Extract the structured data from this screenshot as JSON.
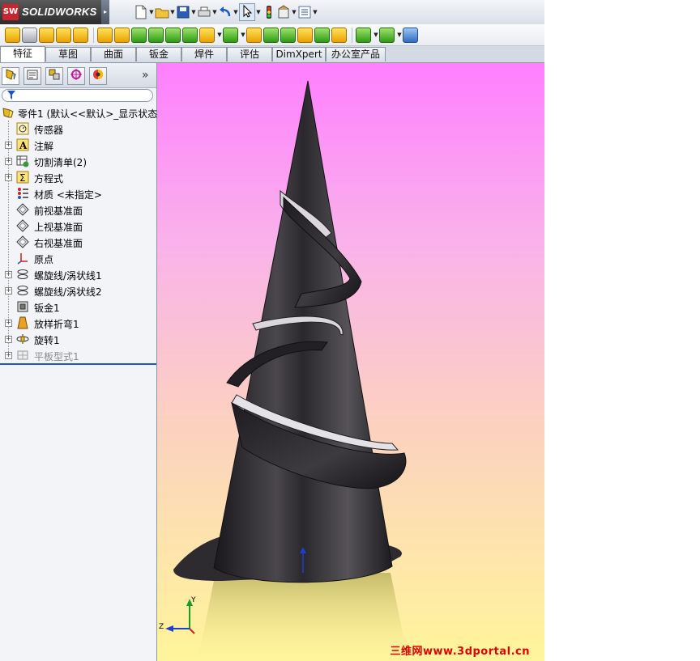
{
  "app": {
    "logo_mark": "SW",
    "logo_text": "SOLIDWORKS",
    "menu_arrow": "▸"
  },
  "toolbar": {
    "icons": [
      "new-icon",
      "open-icon",
      "save-icon",
      "print-icon",
      "undo-icon",
      "select-icon",
      "rebuild-icon",
      "options-icon",
      "list-icon"
    ]
  },
  "feature_toolbar": {
    "icons": [
      "base-flange-icon",
      "convert-icon",
      "miter-flange-icon",
      "hem-icon",
      "jog-icon",
      "sketched-bend-icon",
      "cross-break-icon",
      "closed-corner-icon",
      "welded-corner-icon",
      "break-corner-icon",
      "forming-tool-icon",
      "vent-icon",
      "unfold-icon",
      "fold-icon",
      "flatten-icon",
      "no-bends-icon",
      "rip-icon",
      "insert-bends-icon",
      "extruded-cut-icon",
      "simple-hole-icon",
      "mirror-icon",
      "swept-flange-icon"
    ]
  },
  "tabs": [
    {
      "label": "特征",
      "active": true
    },
    {
      "label": "草图",
      "active": false
    },
    {
      "label": "曲面",
      "active": false
    },
    {
      "label": "钣金",
      "active": false
    },
    {
      "label": "焊件",
      "active": false
    },
    {
      "label": "评估",
      "active": false
    },
    {
      "label": "DimXpert",
      "active": false
    },
    {
      "label": "办公室产品",
      "active": false
    }
  ],
  "panel": {
    "collapse_glyph": "»",
    "splitter_glyph": "◂◂"
  },
  "tree": {
    "root": "零件1 (默认<<默认>_显示状态",
    "items": [
      {
        "label": "传感器",
        "icon": "sensor-icon",
        "expandable": false
      },
      {
        "label": "注解",
        "icon": "annotation-icon",
        "expandable": true
      },
      {
        "label": "切割清单(2)",
        "icon": "cut-list-icon",
        "expandable": true
      },
      {
        "label": "方程式",
        "icon": "equation-icon",
        "expandable": true
      },
      {
        "label": "材质 <未指定>",
        "icon": "material-icon",
        "expandable": false
      },
      {
        "label": "前视基准面",
        "icon": "plane-icon",
        "expandable": false
      },
      {
        "label": "上视基准面",
        "icon": "plane-icon",
        "expandable": false
      },
      {
        "label": "右视基准面",
        "icon": "plane-icon",
        "expandable": false
      },
      {
        "label": "原点",
        "icon": "origin-icon",
        "expandable": false
      },
      {
        "label": "螺旋线/涡状线1",
        "icon": "helix-icon",
        "expandable": true
      },
      {
        "label": "螺旋线/涡状线2",
        "icon": "helix-icon",
        "expandable": true
      },
      {
        "label": "钣金1",
        "icon": "sheet-metal-icon",
        "expandable": false
      },
      {
        "label": "放样折弯1",
        "icon": "lofted-bend-icon",
        "expandable": true
      },
      {
        "label": "旋转1",
        "icon": "revolve-icon",
        "expandable": true
      },
      {
        "label": "平板型式1",
        "icon": "flat-pattern-icon",
        "expandable": true,
        "suppressed": true
      }
    ]
  },
  "viewport": {
    "triad": {
      "y": "Y",
      "z": "Z"
    },
    "watermark": "三维网www.3dportal.cn",
    "colors": {
      "top": "#ff7fff",
      "bottom": "#fff59a",
      "cone": "#2e2c30",
      "accent": "#1c57c7"
    }
  }
}
